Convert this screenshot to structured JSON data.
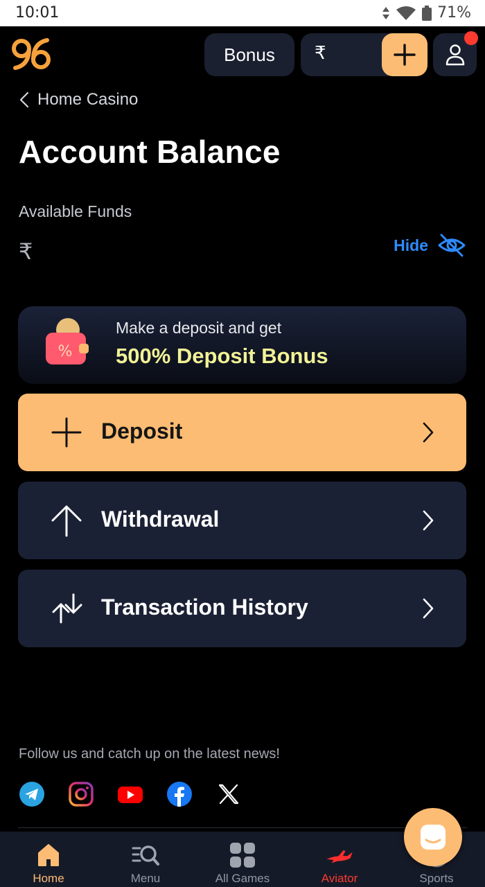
{
  "status_bar": {
    "time": "10:01",
    "battery": "71%"
  },
  "header": {
    "bonus_label": "Bonus",
    "currency_symbol": "₹",
    "accent_color": "#fdbc73"
  },
  "breadcrumb": {
    "label": "Home Casino"
  },
  "page": {
    "title": "Account Balance",
    "available_funds_label": "Available Funds",
    "available_funds_value": "₹",
    "hide_label": "Hide"
  },
  "promo": {
    "line1": "Make a deposit and get",
    "line2": "500% Deposit Bonus"
  },
  "actions": [
    {
      "label": "Deposit",
      "icon": "plus-icon"
    },
    {
      "label": "Withdrawal",
      "icon": "arrow-up-icon"
    },
    {
      "label": "Transaction History",
      "icon": "transfer-arrows-icon"
    }
  ],
  "footer": {
    "follow_text": "Follow us and catch up on the latest news!",
    "socials": [
      "telegram-icon",
      "instagram-icon",
      "youtube-icon",
      "facebook-icon",
      "x-icon"
    ]
  },
  "bottom_nav": [
    {
      "label": "Home",
      "icon": "home-icon",
      "active": true
    },
    {
      "label": "Menu",
      "icon": "menu-search-icon"
    },
    {
      "label": "All Games",
      "icon": "grid-icon"
    },
    {
      "label": "Aviator",
      "icon": "plane-icon"
    },
    {
      "label": "Sports",
      "icon": "ball-icon"
    }
  ]
}
